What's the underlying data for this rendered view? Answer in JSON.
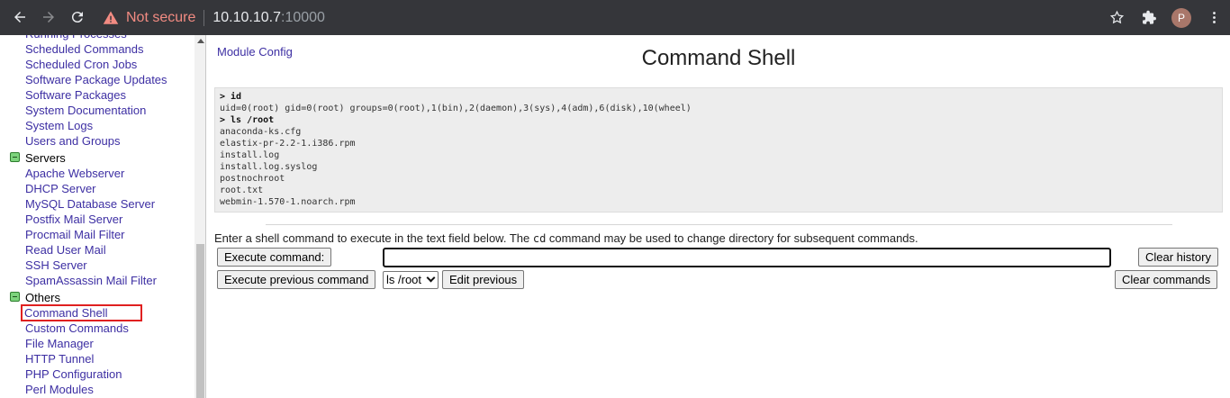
{
  "browser": {
    "security_label": "Not secure",
    "url_host": "10.10.10.7",
    "url_port": ":10000",
    "profile_initial": "P"
  },
  "sidebar": {
    "items": [
      {
        "type": "link",
        "label": "Running Processes"
      },
      {
        "type": "link",
        "label": "Scheduled Commands"
      },
      {
        "type": "link",
        "label": "Scheduled Cron Jobs"
      },
      {
        "type": "link",
        "label": "Software Package Updates"
      },
      {
        "type": "link",
        "label": "Software Packages"
      },
      {
        "type": "link",
        "label": "System Documentation"
      },
      {
        "type": "link",
        "label": "System Logs"
      },
      {
        "type": "link",
        "label": "Users and Groups"
      },
      {
        "type": "category",
        "label": "Servers"
      },
      {
        "type": "link",
        "label": "Apache Webserver"
      },
      {
        "type": "link",
        "label": "DHCP Server"
      },
      {
        "type": "link",
        "label": "MySQL Database Server"
      },
      {
        "type": "link",
        "label": "Postfix Mail Server"
      },
      {
        "type": "link",
        "label": "Procmail Mail Filter"
      },
      {
        "type": "link",
        "label": "Read User Mail"
      },
      {
        "type": "link",
        "label": "SSH Server"
      },
      {
        "type": "link",
        "label": "SpamAssassin Mail Filter"
      },
      {
        "type": "category",
        "label": "Others"
      },
      {
        "type": "link",
        "label": "Command Shell",
        "active": true
      },
      {
        "type": "link",
        "label": "Custom Commands"
      },
      {
        "type": "link",
        "label": "File Manager"
      },
      {
        "type": "link",
        "label": "HTTP Tunnel"
      },
      {
        "type": "link",
        "label": "PHP Configuration"
      },
      {
        "type": "link",
        "label": "Perl Modules"
      }
    ]
  },
  "main": {
    "module_config": "Module Config",
    "title": "Command Shell",
    "output": [
      {
        "kind": "cmd",
        "text": "> id"
      },
      {
        "kind": "out",
        "text": "uid=0(root) gid=0(root) groups=0(root),1(bin),2(daemon),3(sys),4(adm),6(disk),10(wheel)"
      },
      {
        "kind": "cmd",
        "text": "> ls /root"
      },
      {
        "kind": "out",
        "text": "anaconda-ks.cfg"
      },
      {
        "kind": "out",
        "text": "elastix-pr-2.2-1.i386.rpm"
      },
      {
        "kind": "out",
        "text": "install.log"
      },
      {
        "kind": "out",
        "text": "install.log.syslog"
      },
      {
        "kind": "out",
        "text": "postnochroot"
      },
      {
        "kind": "out",
        "text": "root.txt"
      },
      {
        "kind": "out",
        "text": "webmin-1.570-1.noarch.rpm"
      }
    ],
    "instructions_pre": "Enter a shell command to execute in the text field below. The ",
    "instructions_code": "cd",
    "instructions_post": " command may be used to change directory for subsequent commands.",
    "execute_button": "Execute command:",
    "command_value": "",
    "clear_history_button": "Clear history",
    "execute_previous_button": "Execute previous command",
    "previous_select_value": "ls /root",
    "edit_previous_button": "Edit previous",
    "clear_commands_button": "Clear commands"
  }
}
